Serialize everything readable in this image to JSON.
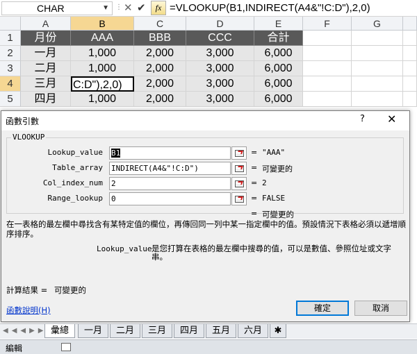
{
  "formula_bar": {
    "name_box": "CHAR",
    "cancel_glyph": "✕",
    "enter_glyph": "✔",
    "fx_label": "fx",
    "formula": "=VLOOKUP(B1,INDIRECT(A4&\"!C:D\"),2,0)"
  },
  "sheet": {
    "columns": [
      "A",
      "B",
      "C",
      "D",
      "E",
      "F",
      "G"
    ],
    "rows": [
      "1",
      "2",
      "3",
      "4",
      "5"
    ],
    "cells": [
      [
        "月份",
        "AAA",
        "BBB",
        "CCC",
        "合計"
      ],
      [
        "一月",
        "1,000",
        "2,000",
        "3,000",
        "6,000"
      ],
      [
        "二月",
        "1,000",
        "2,000",
        "3,000",
        "6,000"
      ],
      [
        "三月",
        "C:D\"),2,0)",
        "2,000",
        "3,000",
        "6,000"
      ],
      [
        "四月",
        "1,000",
        "2,000",
        "3,000",
        "6,000"
      ]
    ]
  },
  "dialog": {
    "title": "函數引數",
    "help_q": "?",
    "close_glyph": "✕",
    "function_name": "VLOOKUP",
    "args": [
      {
        "label": "Lookup_value",
        "value": "B1",
        "result": "\"AAA\""
      },
      {
        "label": "Table_array",
        "value": "INDIRECT(A4&\"!C:D\")",
        "result": "可變更的"
      },
      {
        "label": "Col_index_num",
        "value": "2",
        "result": "2"
      },
      {
        "label": "Range_lookup",
        "value": "0",
        "result": "FALSE"
      }
    ],
    "equals": "=",
    "formula_result_line": "可變更的",
    "description": "在一表格的最左欄中尋找含有某特定值的欄位，再傳回同一列中某一指定欄中的值。預設情況下表格必須以遞增順序排序。",
    "arg_desc_name": "Lookup_value",
    "arg_desc_text": "是您打算在表格的最左欄中搜尋的值，可以是數值、參照位址或文字串。",
    "calc_label": "計算結果 =",
    "calc_value": "可變更的",
    "help_link": "函數說明(H)",
    "ok_label": "確定",
    "cancel_label": "取消"
  },
  "tabs": {
    "nav": "◀◀◀▶▶▶",
    "items": [
      "彙總",
      "一月",
      "二月",
      "三月",
      "四月",
      "五月",
      "六月"
    ],
    "add_glyph": "✱"
  },
  "status": {
    "mode": "編輯"
  }
}
